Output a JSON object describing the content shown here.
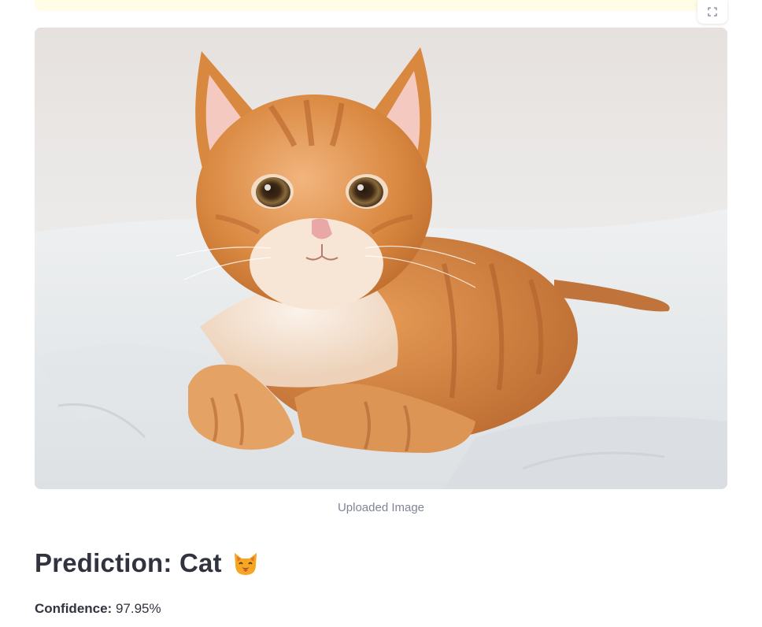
{
  "image": {
    "caption": "Uploaded Image",
    "subject": "orange tabby cat lying on white blanket"
  },
  "result": {
    "heading_prefix": "Prediction:",
    "label": "Cat",
    "emoji": "cat-face-icon",
    "confidence_label": "Confidence:",
    "confidence_value": "97.95%"
  },
  "toolbar": {
    "fullscreen_icon": "fullscreen-icon"
  },
  "colors": {
    "alert_bg": "#fffce7",
    "text": "#31333f",
    "caption": "#808495",
    "cat_orange": "#d9833f"
  }
}
